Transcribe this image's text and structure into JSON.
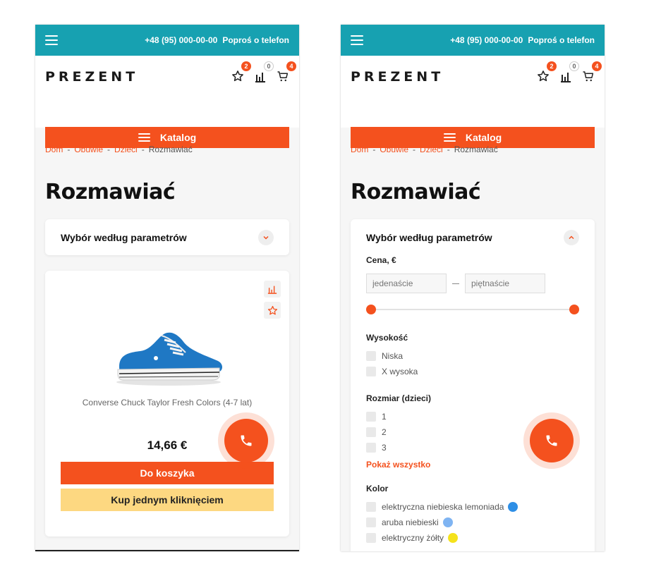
{
  "topbar": {
    "phone": "+48 (95) 000-00-00",
    "callback": "Poproś o telefon"
  },
  "header": {
    "logo": "PREZENT",
    "favorites_count": "2",
    "compare_count": "0",
    "cart_count": "4",
    "catalog_label": "Katalog"
  },
  "breadcrumb": [
    "Dom",
    "Obuwie",
    "Dzieci",
    "Rozmawiać"
  ],
  "page_title": "Rozmawiać",
  "filter": {
    "title": "Wybór według parametrów",
    "price_label": "Cena, €",
    "price_from_placeholder": "jedenaście",
    "price_to_placeholder": "piętnaście",
    "price_slider_range": [
      0,
      1
    ],
    "height_label": "Wysokość",
    "height_options": [
      "Niska",
      "X wysoka"
    ],
    "size_label": "Rozmiar (dzieci)",
    "size_options": [
      "1",
      "2",
      "3"
    ],
    "show_all": "Pokaż wszystko",
    "color_label": "Kolor",
    "color_options": [
      {
        "label": "elektryczna niebieska lemoniada",
        "color": "#2e8fe6"
      },
      {
        "label": "aruba niebieski",
        "color": "#7fb4f2"
      },
      {
        "label": "elektryczny żółty",
        "color": "#f5e21c"
      }
    ]
  },
  "product": {
    "name": "Converse Chuck Taylor Fresh Colors (4-7 lat)",
    "price": "14,66 €",
    "add_to_cart": "Do koszyka",
    "one_click": "Kup jednym kliknięciem"
  },
  "colors": {
    "accent": "#f4511e",
    "topbar": "#17a1b1",
    "one_click": "#fdd881"
  }
}
